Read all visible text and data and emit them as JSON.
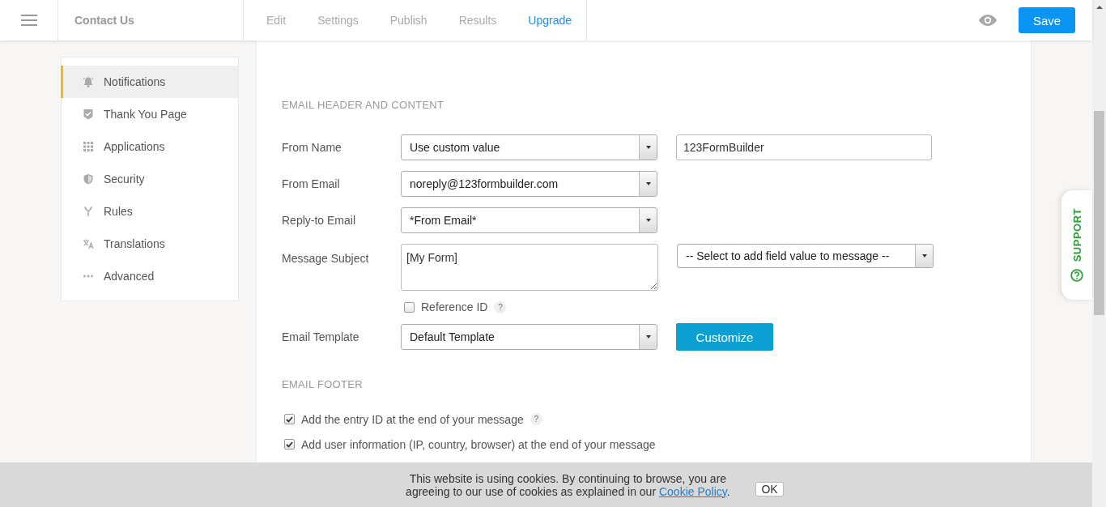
{
  "topbar": {
    "form_title": "Contact Us",
    "tabs": [
      {
        "label": "Edit",
        "kind": "tab"
      },
      {
        "label": "Settings",
        "kind": "tab"
      },
      {
        "label": "Publish",
        "kind": "tab"
      },
      {
        "label": "Results",
        "kind": "tab"
      },
      {
        "label": "Upgrade",
        "kind": "upgrade"
      }
    ],
    "save": "Save"
  },
  "sidebar": {
    "items": [
      {
        "label": "Notifications",
        "kind": "bell",
        "selected": true
      },
      {
        "label": "Thank You Page",
        "kind": "badge",
        "selected": false
      },
      {
        "label": "Applications",
        "kind": "grid",
        "selected": false
      },
      {
        "label": "Security",
        "kind": "shield",
        "selected": false
      },
      {
        "label": "Rules",
        "kind": "fork",
        "selected": false
      },
      {
        "label": "Translations",
        "kind": "translate",
        "selected": false
      },
      {
        "label": "Advanced",
        "kind": "dots",
        "selected": false
      }
    ]
  },
  "email_header": {
    "heading": "EMAIL HEADER AND CONTENT",
    "fields": [
      {
        "kind": "select",
        "label": "From Name",
        "value": "Use custom value",
        "side": {
          "kind": "input",
          "value": "123FormBuilder"
        }
      },
      {
        "kind": "select",
        "label": "From Email",
        "value": "noreply@123formbuilder.com"
      },
      {
        "kind": "select",
        "label": "Reply-to Email",
        "value": "*From Email*"
      },
      {
        "kind": "textarea",
        "label": "Message Subject",
        "value": "[My Form]",
        "side": {
          "kind": "select",
          "value": "-- Select to add field value to message --"
        }
      },
      {
        "kind": "checkbox",
        "label": "Reference ID",
        "checked": false,
        "help": "?"
      },
      {
        "kind": "select",
        "label": "Email Template",
        "value": "Default Template",
        "side": {
          "kind": "button",
          "label": "Customize"
        }
      }
    ]
  },
  "email_footer": {
    "heading": "EMAIL FOOTER",
    "options": [
      {
        "label": "Add the entry ID at the end of your message",
        "checked": true,
        "help": "?"
      },
      {
        "label": "Add user information (IP, country, browser) at the end of your message",
        "checked": true
      }
    ]
  },
  "support_tab": {
    "label": "SUPPORT"
  },
  "cookie_banner": {
    "text": "This website is using cookies. By continuing to browse, you are agreeing to our use of cookies as explained in our ",
    "link": "Cookie Policy",
    "after": ".",
    "button": "OK"
  }
}
